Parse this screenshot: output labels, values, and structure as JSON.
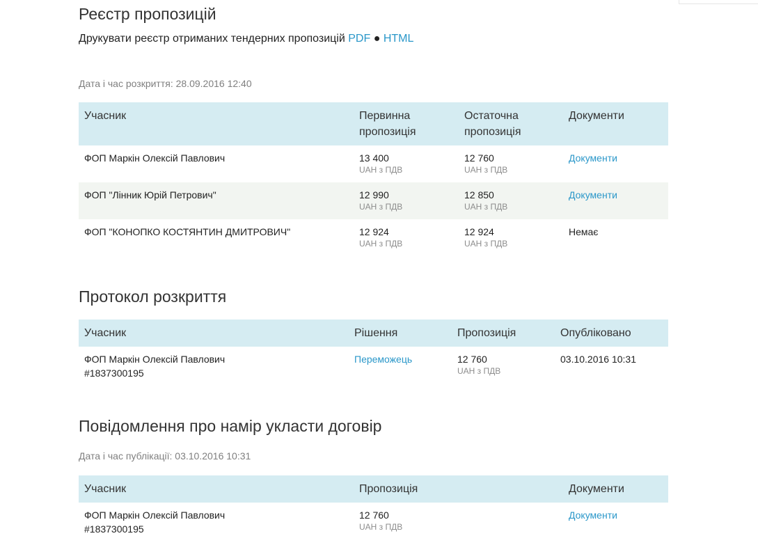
{
  "bids": {
    "title": "Реєстр пропозицій",
    "print_text": "Друкувати реєстр отриманих тендерних пропозицій",
    "pdf_link": "PDF",
    "separator": "●",
    "html_link": "HTML",
    "open_datetime": "Дата і час розкриття: 28.09.2016 12:40",
    "headers": {
      "participant": "Учасник",
      "initial_line1": "Первинна",
      "initial_line2": "пропозиція",
      "final_line1": "Остаточна",
      "final_line2": "пропозиція",
      "documents": "Документи"
    },
    "rows": [
      {
        "participant": "ФОП Маркін Олексій Павлович",
        "initial": "13 400",
        "initial_unit": "UAH з ПДВ",
        "final": "12 760",
        "final_unit": "UAH з ПДВ",
        "documents": "Документи"
      },
      {
        "participant": "ФОП \"Лінник Юрій Петрович\"",
        "initial": "12 990",
        "initial_unit": "UAH з ПДВ",
        "final": "12 850",
        "final_unit": "UAH з ПДВ",
        "documents": "Документи"
      },
      {
        "participant": "ФОП \"КОНОПКО КОСТЯНТИН ДМИТРОВИЧ\"",
        "initial": "12 924",
        "initial_unit": "UAH з ПДВ",
        "final": "12 924",
        "final_unit": "UAH з ПДВ",
        "documents": "Немає"
      }
    ]
  },
  "protocol": {
    "title": "Протокол розкриття",
    "headers": {
      "participant": "Учасник",
      "decision": "Рішення",
      "offer": "Пропозиція",
      "published": "Опубліковано"
    },
    "rows": [
      {
        "participant": "ФОП Маркін Олексій Павлович",
        "participant_id": "#1837300195",
        "decision": "Переможець",
        "offer": "12 760",
        "offer_unit": "UAH з ПДВ",
        "published": "03.10.2016 10:31"
      }
    ]
  },
  "notice": {
    "title": "Повідомлення про намір укласти договір",
    "published_datetime": "Дата і час публікації: 03.10.2016 10:31",
    "headers": {
      "participant": "Учасник",
      "offer": "Пропозиція",
      "documents": "Документи"
    },
    "rows": [
      {
        "participant": "ФОП Маркін Олексій Павлович",
        "participant_id": "#1837300195",
        "offer": "12 760",
        "offer_unit": "UAH з ПДВ",
        "documents": "Документи"
      }
    ]
  },
  "colors": {
    "link": "#2a97c9",
    "table_header_bg": "#d5ecf2",
    "alt_row_bg": "#f2f5f1",
    "muted_text": "#7f7f7f"
  }
}
